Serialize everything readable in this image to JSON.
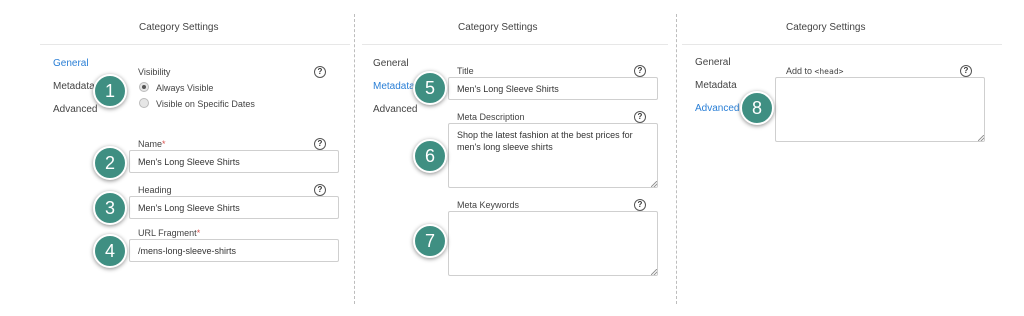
{
  "panels": [
    {
      "title": "Category Settings",
      "nav": [
        "General",
        "Metadata",
        "Advanced"
      ],
      "active_nav": "General"
    },
    {
      "title": "Category Settings",
      "nav": [
        "General",
        "Metadata",
        "Advanced"
      ],
      "active_nav": "Metadata"
    },
    {
      "title": "Category Settings",
      "nav": [
        "General",
        "Metadata",
        "Advanced"
      ],
      "active_nav": "Advanced"
    }
  ],
  "general": {
    "visibility_label": "Visibility",
    "visibility_options": [
      "Always Visible",
      "Visible on Specific Dates"
    ],
    "visibility_selected": "Always Visible",
    "name_label": "Name",
    "name_value": "Men's Long Sleeve Shirts",
    "heading_label": "Heading",
    "heading_value": "Men's Long Sleeve Shirts",
    "url_label": "URL Fragment",
    "url_value": "/mens-long-sleeve-shirts",
    "required_mark": "*"
  },
  "metadata": {
    "title_label": "Title",
    "title_value": "Men's Long Sleeve Shirts",
    "description_label": "Meta Description",
    "description_value": "Shop the latest fashion at the best prices for men's long sleeve shirts",
    "keywords_label": "Meta Keywords",
    "keywords_value": ""
  },
  "advanced": {
    "add_to_label": "Add to",
    "add_to_code": "<head>",
    "head_value": ""
  },
  "help_glyph": "?",
  "badges": [
    "1",
    "2",
    "3",
    "4",
    "5",
    "6",
    "7",
    "8"
  ],
  "colors": {
    "accent": "#2a7fd6",
    "badge": "#3f8f82",
    "required": "#d9534f"
  }
}
